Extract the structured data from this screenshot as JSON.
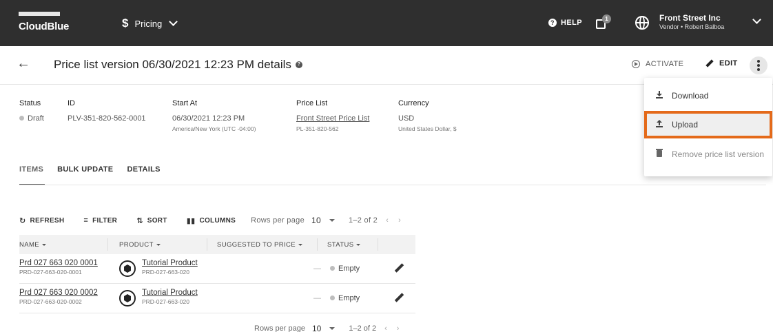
{
  "topbar": {
    "logo_text": "CloudBlue",
    "app_symbol": "$",
    "app_name": "Pricing",
    "help_label": "HELP",
    "notification_count": "1",
    "account_name": "Front Street Inc",
    "account_sub": "Vendor • Robert Balboa"
  },
  "header": {
    "back_icon": "arrow-left-icon",
    "title": "Price list version 06/30/2021 12:23 PM details",
    "activate_label": "ACTIVATE",
    "edit_label": "EDIT"
  },
  "details": {
    "status": {
      "label": "Status",
      "value": "Draft"
    },
    "id": {
      "label": "ID",
      "value": "PLV-351-820-562-0001"
    },
    "start_at": {
      "label": "Start At",
      "value": "06/30/2021 12:23 PM",
      "sub": "America/New York (UTC -04:00)"
    },
    "price_list": {
      "label": "Price List",
      "value": "Front Street Price List",
      "sub": "PL-351-820-562"
    },
    "currency": {
      "label": "Currency",
      "value": "USD",
      "sub": "United States Dollar, $"
    }
  },
  "tabs": [
    {
      "label": "ITEMS",
      "active": true
    },
    {
      "label": "BULK UPDATE",
      "active": false
    },
    {
      "label": "DETAILS",
      "active": false
    }
  ],
  "toolbar": {
    "refresh_label": "REFRESH",
    "filter_label": "FILTER",
    "sort_label": "SORT",
    "columns_label": "COLUMNS",
    "rows_per_page_label": "Rows per page",
    "rows_per_page_value": "10",
    "range_text": "1–2 of 2"
  },
  "table": {
    "headers": [
      "NAME",
      "PRODUCT",
      "SUGGESTED TO PRICE",
      "STATUS"
    ],
    "rows": [
      {
        "name": "Prd 027 663 020 0001",
        "name_id": "PRD-027-663-020-0001",
        "product": "Tutorial Product",
        "product_id": "PRD-027-663-020",
        "suggested": "—",
        "status": "Empty"
      },
      {
        "name": "Prd 027 663 020 0002",
        "name_id": "PRD-027-663-020-0002",
        "product": "Tutorial Product",
        "product_id": "PRD-027-663-020",
        "suggested": "—",
        "status": "Empty"
      }
    ]
  },
  "bottom_pagination": {
    "rows_per_page_label": "Rows per page",
    "rows_per_page_value": "10",
    "range_text": "1–2 of 2"
  },
  "menu": {
    "items": [
      {
        "label": "Download",
        "icon": "download-icon"
      },
      {
        "label": "Upload",
        "icon": "upload-icon"
      },
      {
        "label": "Remove price list version",
        "icon": "trash-icon"
      }
    ]
  },
  "colors": {
    "topbar_bg": "#2f2f2f",
    "highlight_outline": "#e46a1a"
  }
}
